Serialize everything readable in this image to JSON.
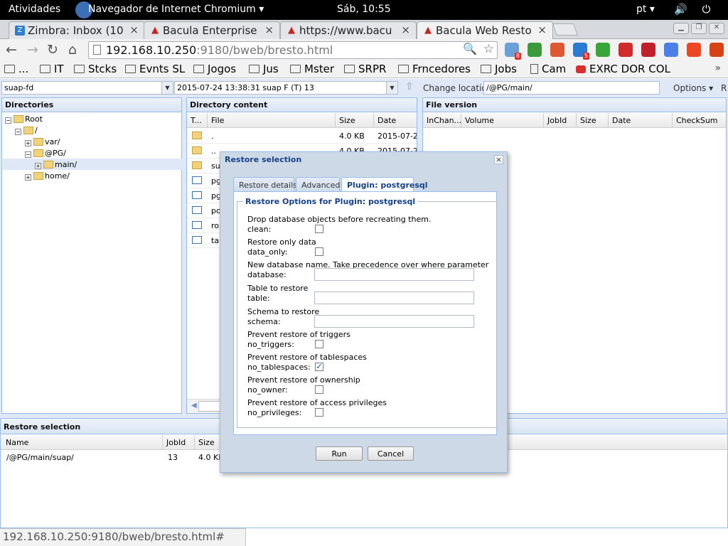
{
  "topbar": {
    "activities": "Atividades",
    "app_name": "Navegador de Internet Chromium ▾",
    "clock": "Sáb, 10:55",
    "lang": "pt ▾",
    "sys_icons": "🔊 ⏻ ▾"
  },
  "tabs": [
    {
      "label": "Zimbra: Inbox (10",
      "icon": "zimbra-icon",
      "fav": "Z"
    },
    {
      "label": "Bacula Enterprise",
      "icon": "bacula-icon",
      "fav": "▲"
    },
    {
      "label": "https://www.bacu",
      "icon": "bacula-icon",
      "fav": "▲"
    },
    {
      "label": "Bacula Web Resto",
      "icon": "bacula-icon",
      "fav": "▲"
    }
  ],
  "tab_close": "×",
  "window_buttons": {
    "minimize": "▁",
    "restore": "❐",
    "close": "✕"
  },
  "toolbar": {
    "back": "←",
    "forward": "→",
    "reload": "↻",
    "home": "⌂",
    "url_host": "192.168.10.250",
    "url_rest": ":9180/bweb/bresto.html",
    "zoom_glyph": "🔍",
    "star_glyph": "☆"
  },
  "extensions": [
    {
      "name": "ext-tab-counter-icon",
      "color": "#6aa0d8",
      "badge": "8"
    },
    {
      "name": "ext-green-flag-icon",
      "color": "#3b9b3b",
      "badge": ""
    },
    {
      "name": "ext-duckduckgo-icon",
      "color": "#de5833",
      "badge": ""
    },
    {
      "name": "ext-checker-icon",
      "color": "#2a7bd4",
      "badge": "5"
    },
    {
      "name": "ext-balloon-icon",
      "color": "#3aa63a",
      "badge": ""
    },
    {
      "name": "ext-stop-icon",
      "color": "#d12a2a",
      "badge": ""
    },
    {
      "name": "ext-adblock-icon",
      "color": "#c0202a",
      "badge": ""
    },
    {
      "name": "ext-translate-icon",
      "color": "#4a80e8",
      "badge": ""
    },
    {
      "name": "ext-stumbleupon-icon",
      "color": "#eb4823",
      "badge": ""
    },
    {
      "name": "ext-user-icon",
      "color": "#d84315",
      "badge": ""
    }
  ],
  "bookmarks": [
    {
      "label": "...",
      "type": "folder"
    },
    {
      "label": "IT",
      "type": "folder"
    },
    {
      "label": "Stcks",
      "type": "folder"
    },
    {
      "label": "Evnts SL",
      "type": "folder"
    },
    {
      "label": "Jogos",
      "type": "folder"
    },
    {
      "label": "Jus",
      "type": "folder"
    },
    {
      "label": "Mster",
      "type": "folder"
    },
    {
      "label": "SRPR",
      "type": "folder"
    },
    {
      "label": "Frncedores",
      "type": "folder"
    },
    {
      "label": "Jobs",
      "type": "folder"
    },
    {
      "label": "Cam",
      "type": "page"
    },
    {
      "label": "EXRC DOR COL",
      "type": "youtube"
    }
  ],
  "bookmarks_more": "»",
  "app": {
    "client": "suap-fd",
    "job": "2015-07-24 13:38:31 suap F (T) 13",
    "combo_trigger": "▼",
    "up_glyph": "⇧",
    "change_location": "Change location",
    "location": "/@PG/main/",
    "options": "Options ▾",
    "overflow": "R"
  },
  "directories": {
    "title": "Directories",
    "nodes": [
      {
        "label": "Root",
        "exp": "−"
      },
      {
        "label": "/",
        "exp": "−"
      },
      {
        "label": "var/",
        "exp": "+"
      },
      {
        "label": "@PG/",
        "exp": "−"
      },
      {
        "label": "main/",
        "exp": "+"
      },
      {
        "label": "home/",
        "exp": "+"
      }
    ]
  },
  "directory_content": {
    "title": "Directory content",
    "columns": [
      "T...",
      "File",
      "Size",
      "Date"
    ],
    "rows": [
      {
        "file": ".",
        "size": "4.0 KB",
        "date": "2015-07-24 0",
        "type": "folder"
      },
      {
        "file": "..",
        "size": "4.0 KB",
        "date": "2015-07-24 0",
        "type": "folder"
      },
      {
        "file": "suap",
        "size": "4.0 KB",
        "date": "2015-07-24 0",
        "type": "folder"
      },
      {
        "file": "pg_",
        "size": "",
        "date": "",
        "type": "file"
      },
      {
        "file": "pg_",
        "size": "",
        "date": "",
        "type": "file"
      },
      {
        "file": "pos",
        "size": "",
        "date": "",
        "type": "file"
      },
      {
        "file": "role",
        "size": "",
        "date": "",
        "type": "file"
      },
      {
        "file": "tabl",
        "size": "",
        "date": "",
        "type": "file"
      }
    ],
    "scroll_left": "◀"
  },
  "file_version": {
    "title": "File version",
    "columns": [
      "InChan...",
      "Volume",
      "JobId",
      "Size",
      "Date",
      "CheckSum"
    ]
  },
  "restore_selection": {
    "title": "Restore selection",
    "columns": [
      "Name",
      "JobId",
      "Size"
    ],
    "rows": [
      {
        "name": "/@PG/main/suap/",
        "jobid": "13",
        "size": "4.0 KB"
      }
    ]
  },
  "modal": {
    "title": "Restore selection",
    "close": "×",
    "tabs": [
      "Restore details",
      "Advanced",
      "Plugin: postgresql"
    ],
    "legend": "Restore Options for Plugin: postgresql",
    "options": [
      {
        "desc": "Drop database objects before recreating them.",
        "label": "clean:",
        "kind": "checkbox",
        "checked": false
      },
      {
        "desc": "Restore only data",
        "label": "data_only:",
        "kind": "checkbox",
        "checked": false
      },
      {
        "desc": "New database name. Take precedence over where parameter",
        "label": "database:",
        "kind": "text",
        "value": ""
      },
      {
        "desc": "Table to restore",
        "label": "table:",
        "kind": "text",
        "value": ""
      },
      {
        "desc": "Schema to restore",
        "label": "schema:",
        "kind": "text",
        "value": ""
      },
      {
        "desc": "Prevent restore of triggers",
        "label": "no_triggers:",
        "kind": "checkbox",
        "checked": false
      },
      {
        "desc": "Prevent restore of tablespaces",
        "label": "no_tablespaces:",
        "kind": "checkbox",
        "checked": true
      },
      {
        "desc": "Prevent restore of ownership",
        "label": "no_owner:",
        "kind": "checkbox",
        "checked": false
      },
      {
        "desc": "Prevent restore of access privileges",
        "label": "no_privileges:",
        "kind": "checkbox",
        "checked": false
      }
    ],
    "check_glyph": "✓",
    "run_label": "Run",
    "cancel_label": "Cancel"
  },
  "statusbar": "192.168.10.250:9180/bweb/bresto.html#"
}
